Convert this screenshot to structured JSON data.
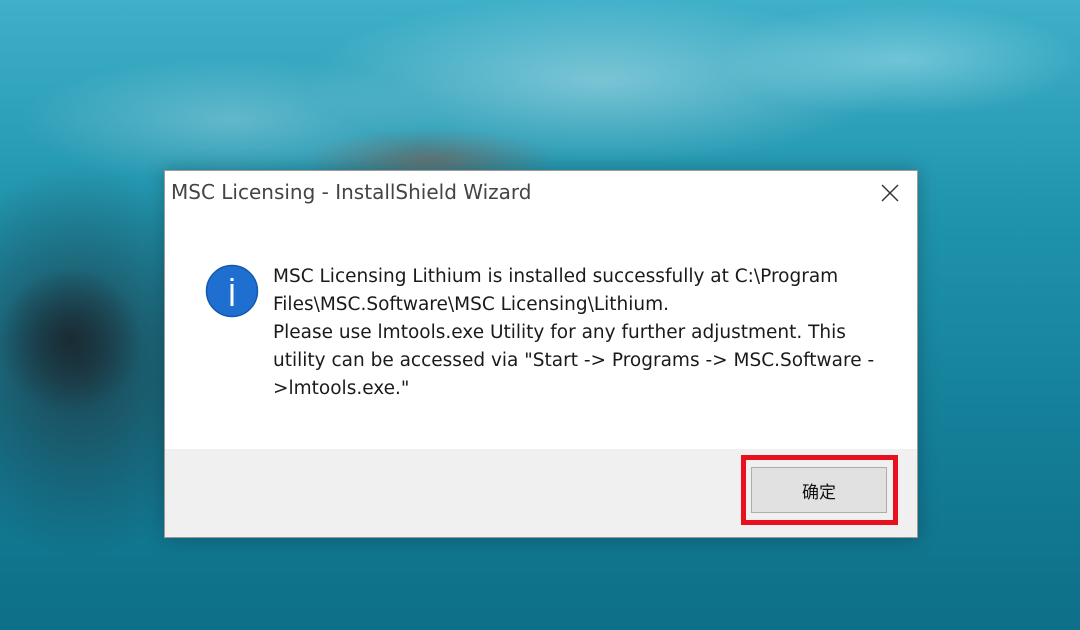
{
  "dialog": {
    "title": "MSC Licensing - InstallShield Wizard",
    "icon": "info-icon",
    "message_lines": [
      "MSC Licensing Lithium is installed successfully at C:\\Program Files\\MSC.Software\\MSC Licensing\\Lithium.",
      "Please use lmtools.exe Utility for any further adjustment. This utility can be accessed via \"Start -> Programs -> MSC.Software ->lmtools.exe.\""
    ],
    "ok_label": "确定",
    "close_icon": "close-icon"
  },
  "colors": {
    "info_icon_fill": "#1e6fd0",
    "highlight_border": "#e8101e",
    "footer_background": "#f0f0f0"
  }
}
